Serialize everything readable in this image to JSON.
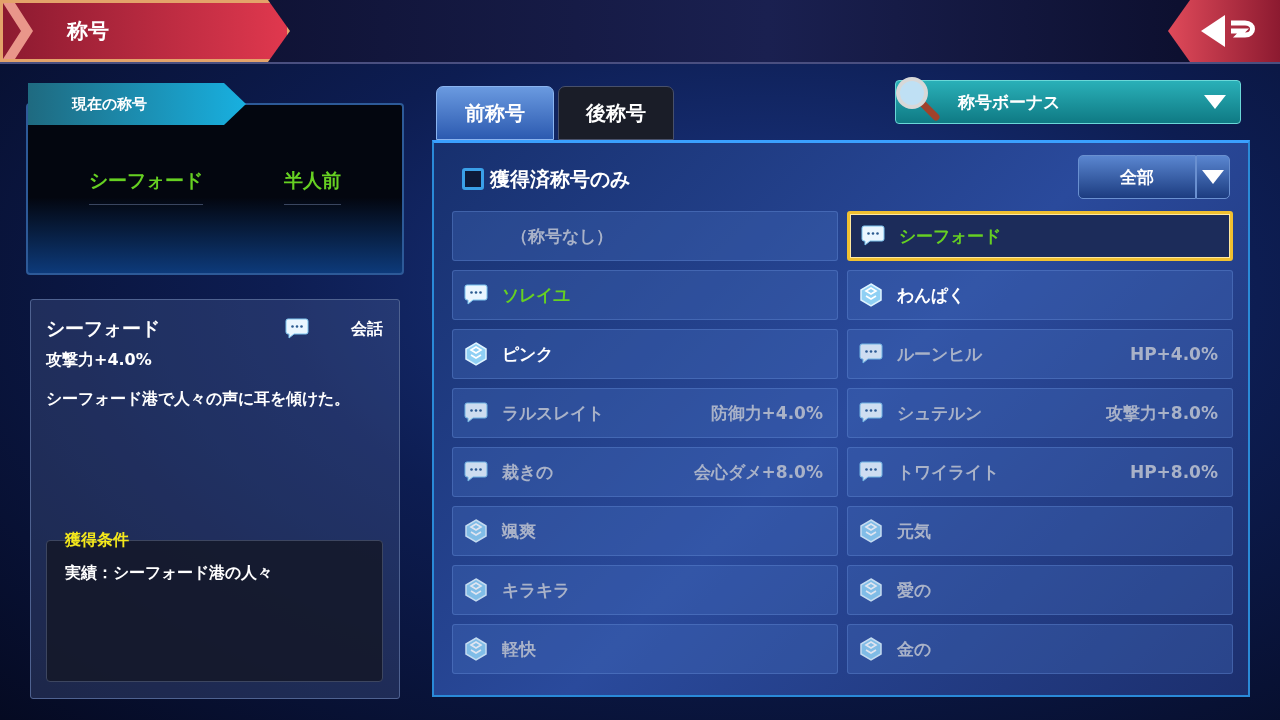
{
  "header": {
    "title": "称号"
  },
  "current_title": {
    "label": "現在の称号",
    "prefix": "シーフォード",
    "suffix": "半人前"
  },
  "detail": {
    "name": "シーフォード",
    "kind": "chat",
    "type_label": "会話",
    "bonus": "攻撃力+4.0%",
    "description": "シーフォード港で人々の声に耳を傾けた。",
    "condition_label": "獲得条件",
    "condition": "実績：シーフォード港の人々"
  },
  "tabs": [
    {
      "label": "前称号",
      "selected": true
    },
    {
      "label": "後称号",
      "selected": false
    }
  ],
  "bonus_filter": {
    "value": "称号ボーナス"
  },
  "owned_only": {
    "label": "獲得済称号のみ",
    "checked": false
  },
  "category_filter": {
    "value": "全部"
  },
  "titles": [
    {
      "name": "（称号なし）",
      "kind": "none",
      "equipped": false,
      "owned": false,
      "selected": false
    },
    {
      "name": "シーフォード",
      "kind": "chat",
      "equipped": true,
      "owned": true,
      "selected": true
    },
    {
      "name": "ソレイユ",
      "kind": "chat",
      "equipped": true,
      "owned": true,
      "selected": false
    },
    {
      "name": "わんぱく",
      "kind": "gem",
      "equipped": false,
      "owned": true,
      "selected": false
    },
    {
      "name": "ピンク",
      "kind": "gem",
      "equipped": false,
      "owned": true,
      "selected": false
    },
    {
      "name": "ルーンヒル",
      "kind": "chat",
      "equipped": false,
      "owned": false,
      "bonus": "HP+4.0%",
      "selected": false
    },
    {
      "name": "ラルスレイト",
      "kind": "chat",
      "equipped": false,
      "owned": false,
      "bonus": "防御力+4.0%",
      "selected": false
    },
    {
      "name": "シュテルン",
      "kind": "chat",
      "equipped": false,
      "owned": false,
      "bonus": "攻撃力+8.0%",
      "selected": false
    },
    {
      "name": "裁きの",
      "kind": "chat",
      "equipped": false,
      "owned": false,
      "bonus": "会心ダメ+8.0%",
      "selected": false
    },
    {
      "name": "トワイライト",
      "kind": "chat",
      "equipped": false,
      "owned": false,
      "bonus": "HP+8.0%",
      "selected": false
    },
    {
      "name": "颯爽",
      "kind": "gem",
      "equipped": false,
      "owned": false,
      "selected": false
    },
    {
      "name": "元気",
      "kind": "gem",
      "equipped": false,
      "owned": false,
      "selected": false
    },
    {
      "name": "キラキラ",
      "kind": "gem",
      "equipped": false,
      "owned": false,
      "selected": false
    },
    {
      "name": "愛の",
      "kind": "gem",
      "equipped": false,
      "owned": false,
      "selected": false
    },
    {
      "name": "軽快",
      "kind": "gem",
      "equipped": false,
      "owned": false,
      "selected": false
    },
    {
      "name": "金の",
      "kind": "gem",
      "equipped": false,
      "owned": false,
      "selected": false
    }
  ]
}
